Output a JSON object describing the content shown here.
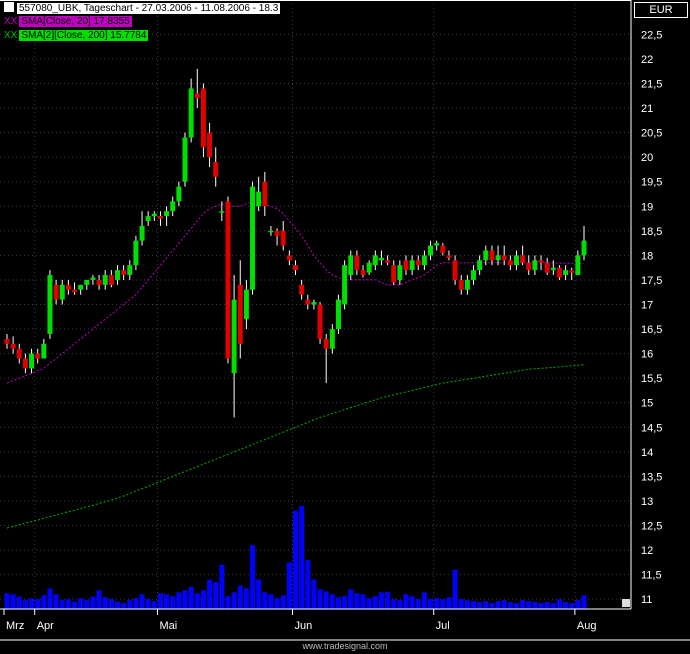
{
  "header": {
    "instrument_label": "557080_UBK, Tageschart - 27.03.2006 - 11.08.2006 - 18.3",
    "sma20_tag": "XX",
    "sma20_label": "SMA[Close, 20] 17.8355",
    "sma200_tag": "XX",
    "sma200_label": "SMA[2][Close, 200] 15.7784",
    "currency": "EUR"
  },
  "footer": {
    "credit": "www.tradesignal.com"
  },
  "colors": {
    "up": "#00e000",
    "down": "#e00000",
    "sma20": "#c000c0",
    "sma200": "#00b000",
    "volume": "#0000ff",
    "grid": "#3c3c3c"
  },
  "chart_data": {
    "type": "candlestick",
    "title": "557080_UBK, Tageschart - 27.03.2006 - 11.08.2006 - 18.3",
    "y_ticks": [
      "11",
      "11,5",
      "12",
      "12,5",
      "13",
      "13,5",
      "14",
      "14,5",
      "15",
      "15,5",
      "16",
      "16,5",
      "17",
      "17,5",
      "18",
      "18,5",
      "19",
      "19,5",
      "20",
      "20,5",
      "21",
      "21,5",
      "22",
      "22,5"
    ],
    "y_tick_values": [
      11,
      11.5,
      12,
      12.5,
      13,
      13.5,
      14,
      14.5,
      15,
      15.5,
      16,
      16.5,
      17,
      17.5,
      18,
      18.5,
      19,
      19.5,
      20,
      20.5,
      21,
      21.5,
      22,
      22.5
    ],
    "ylim": [
      10.8,
      23.2
    ],
    "x_labels": [
      "Mrz",
      "Apr",
      "Mai",
      "Jun",
      "Jul",
      "Aug"
    ],
    "x_label_index": [
      0,
      5,
      25,
      47,
      70,
      93
    ],
    "grid": true,
    "series": [
      {
        "name": "557080_UBK",
        "ohlc": [
          [
            16.3,
            16.4,
            16.1,
            16.2
          ],
          [
            16.2,
            16.35,
            16.0,
            16.1
          ],
          [
            16.1,
            16.2,
            15.8,
            15.9
          ],
          [
            15.9,
            16.0,
            15.6,
            15.7
          ],
          [
            15.7,
            16.1,
            15.6,
            16.0
          ],
          [
            16.0,
            16.1,
            15.8,
            15.9
          ],
          [
            15.9,
            16.3,
            15.9,
            16.2
          ],
          [
            16.4,
            17.7,
            16.3,
            17.6
          ],
          [
            17.4,
            17.5,
            17.0,
            17.1
          ],
          [
            17.1,
            17.5,
            17.0,
            17.4
          ],
          [
            17.4,
            17.5,
            17.2,
            17.3
          ],
          [
            17.3,
            17.45,
            17.2,
            17.25
          ],
          [
            17.3,
            17.4,
            17.2,
            17.4
          ],
          [
            17.4,
            17.5,
            17.3,
            17.5
          ],
          [
            17.5,
            17.6,
            17.4,
            17.55
          ],
          [
            17.5,
            17.6,
            17.3,
            17.4
          ],
          [
            17.4,
            17.7,
            17.3,
            17.6
          ],
          [
            17.6,
            17.7,
            17.35,
            17.4
          ],
          [
            17.5,
            17.8,
            17.4,
            17.7
          ],
          [
            17.7,
            17.8,
            17.5,
            17.6
          ],
          [
            17.6,
            17.9,
            17.5,
            17.8
          ],
          [
            17.8,
            18.4,
            17.7,
            18.3
          ],
          [
            18.3,
            18.9,
            18.2,
            18.6
          ],
          [
            18.7,
            18.9,
            18.6,
            18.8
          ],
          [
            18.8,
            18.9,
            18.7,
            18.85
          ],
          [
            18.8,
            18.9,
            18.6,
            18.75
          ],
          [
            18.8,
            19.0,
            18.6,
            18.9
          ],
          [
            18.9,
            19.2,
            18.8,
            19.1
          ],
          [
            19.1,
            19.5,
            19.0,
            19.4
          ],
          [
            19.5,
            20.5,
            19.4,
            20.4
          ],
          [
            20.4,
            21.6,
            20.3,
            21.4
          ],
          [
            21.3,
            21.8,
            21.0,
            21.2
          ],
          [
            21.4,
            21.5,
            20.0,
            20.2
          ],
          [
            20.5,
            20.7,
            19.8,
            20.0
          ],
          [
            19.9,
            20.2,
            19.4,
            19.6
          ],
          [
            18.9,
            19.1,
            18.7,
            18.9
          ],
          [
            19.1,
            19.2,
            15.8,
            15.9
          ],
          [
            15.6,
            17.6,
            14.7,
            17.1
          ],
          [
            17.4,
            17.9,
            15.9,
            16.2
          ],
          [
            16.7,
            17.5,
            16.5,
            17.3
          ],
          [
            17.3,
            19.5,
            17.2,
            19.4
          ],
          [
            19.0,
            19.6,
            18.9,
            19.3
          ],
          [
            19.5,
            19.7,
            18.8,
            19.0
          ],
          [
            18.5,
            18.6,
            18.4,
            18.5
          ],
          [
            18.5,
            18.55,
            18.2,
            18.4
          ],
          [
            18.5,
            18.7,
            18.1,
            18.2
          ],
          [
            18.0,
            18.1,
            17.8,
            17.9
          ],
          [
            17.8,
            17.9,
            17.6,
            17.7
          ],
          [
            17.4,
            17.5,
            17.1,
            17.2
          ],
          [
            17.1,
            17.2,
            16.9,
            17.0
          ],
          [
            17.0,
            17.1,
            16.9,
            17.05
          ],
          [
            17.0,
            17.05,
            16.2,
            16.3
          ],
          [
            16.3,
            16.4,
            15.4,
            16.1
          ],
          [
            16.1,
            16.6,
            16.0,
            16.5
          ],
          [
            16.5,
            17.2,
            16.4,
            17.1
          ],
          [
            17.0,
            17.9,
            16.9,
            17.8
          ],
          [
            17.6,
            18.1,
            17.5,
            18.0
          ],
          [
            18.0,
            18.1,
            17.6,
            17.7
          ],
          [
            17.7,
            17.8,
            17.55,
            17.6
          ],
          [
            17.65,
            17.9,
            17.6,
            17.85
          ],
          [
            17.8,
            18.1,
            17.7,
            18.0
          ],
          [
            17.9,
            18.1,
            17.8,
            17.95
          ],
          [
            17.9,
            18.0,
            17.8,
            17.85
          ],
          [
            17.8,
            17.9,
            17.4,
            17.45
          ],
          [
            17.5,
            17.9,
            17.4,
            17.8
          ],
          [
            17.9,
            18.0,
            17.6,
            17.7
          ],
          [
            17.7,
            18.0,
            17.6,
            17.9
          ],
          [
            17.9,
            18.0,
            17.7,
            17.8
          ],
          [
            17.8,
            18.1,
            17.7,
            18.0
          ],
          [
            18.0,
            18.3,
            17.9,
            18.2
          ],
          [
            18.2,
            18.3,
            18.1,
            18.25
          ],
          [
            18.2,
            18.25,
            18.0,
            18.05
          ],
          [
            18.0,
            18.1,
            17.9,
            17.95
          ],
          [
            17.9,
            18.0,
            17.4,
            17.5
          ],
          [
            17.5,
            17.6,
            17.2,
            17.3
          ],
          [
            17.3,
            17.6,
            17.2,
            17.5
          ],
          [
            17.5,
            17.8,
            17.4,
            17.7
          ],
          [
            17.7,
            18.0,
            17.6,
            17.9
          ],
          [
            17.9,
            18.2,
            17.8,
            18.1
          ],
          [
            18.1,
            18.2,
            17.8,
            17.9
          ],
          [
            17.9,
            18.2,
            17.8,
            18.0
          ],
          [
            18.0,
            18.2,
            17.8,
            17.9
          ],
          [
            17.9,
            18.0,
            17.7,
            17.8
          ],
          [
            17.8,
            18.1,
            17.7,
            18.0
          ],
          [
            18.0,
            18.2,
            17.8,
            17.85
          ],
          [
            17.85,
            18.0,
            17.6,
            17.7
          ],
          [
            17.7,
            18.0,
            17.6,
            17.9
          ],
          [
            17.9,
            18.0,
            17.7,
            17.85
          ],
          [
            17.85,
            17.95,
            17.6,
            17.65
          ],
          [
            17.7,
            17.9,
            17.6,
            17.75
          ],
          [
            17.75,
            17.8,
            17.5,
            17.55
          ],
          [
            17.6,
            17.8,
            17.5,
            17.7
          ],
          [
            17.7,
            17.75,
            17.5,
            17.65
          ],
          [
            17.6,
            18.1,
            17.6,
            18.0
          ],
          [
            18.0,
            18.6,
            17.9,
            18.3
          ]
        ],
        "up_color": "#00e000",
        "down_color": "#e00000"
      },
      {
        "name": "SMA[Close, 20]",
        "start_index": 0,
        "values": [
          15.4,
          15.45,
          15.5,
          15.55,
          15.6,
          15.65,
          15.7,
          15.8,
          15.9,
          16.0,
          16.1,
          16.2,
          16.3,
          16.4,
          16.5,
          16.6,
          16.7,
          16.8,
          16.9,
          17.0,
          17.1,
          17.2,
          17.35,
          17.5,
          17.65,
          17.8,
          17.95,
          18.1,
          18.25,
          18.4,
          18.55,
          18.7,
          18.85,
          18.95,
          19.0,
          19.05,
          19.0,
          19.0,
          19.0,
          19.05,
          19.1,
          19.1,
          19.05,
          19.0,
          18.95,
          18.85,
          18.7,
          18.55,
          18.4,
          18.2,
          18.0,
          17.85,
          17.7,
          17.6,
          17.55,
          17.5,
          17.5,
          17.5,
          17.5,
          17.5,
          17.5,
          17.45,
          17.4,
          17.4,
          17.4,
          17.45,
          17.5,
          17.55,
          17.6,
          17.7,
          17.8,
          17.85,
          17.85,
          17.85,
          17.85,
          17.85,
          17.85,
          17.85,
          17.85,
          17.85,
          17.85,
          17.85,
          17.85,
          17.85,
          17.85,
          17.85,
          17.85,
          17.85,
          17.85,
          17.85,
          17.84,
          17.84,
          17.84,
          17.84,
          17.8355
        ]
      },
      {
        "name": "SMA[2][Close, 200]",
        "start_index": 0,
        "values": [
          12.45,
          12.48,
          12.52,
          12.55,
          12.58,
          12.61,
          12.65,
          12.68,
          12.71,
          12.75,
          12.78,
          12.81,
          12.85,
          12.88,
          12.91,
          12.95,
          12.98,
          13.02,
          13.06,
          13.1,
          13.15,
          13.2,
          13.25,
          13.3,
          13.35,
          13.4,
          13.45,
          13.5,
          13.55,
          13.6,
          13.65,
          13.7,
          13.75,
          13.8,
          13.85,
          13.9,
          13.95,
          14.0,
          14.05,
          14.1,
          14.15,
          14.2,
          14.25,
          14.3,
          14.35,
          14.4,
          14.45,
          14.5,
          14.55,
          14.6,
          14.65,
          14.7,
          14.74,
          14.78,
          14.82,
          14.86,
          14.9,
          14.94,
          14.98,
          15.02,
          15.06,
          15.1,
          15.13,
          15.16,
          15.19,
          15.22,
          15.25,
          15.28,
          15.31,
          15.34,
          15.37,
          15.4,
          15.42,
          15.44,
          15.46,
          15.48,
          15.5,
          15.52,
          15.54,
          15.56,
          15.58,
          15.6,
          15.62,
          15.64,
          15.66,
          15.68,
          15.69,
          15.7,
          15.71,
          15.72,
          15.73,
          15.74,
          15.75,
          15.76,
          15.7784
        ]
      },
      {
        "name": "Volume",
        "values": [
          0.32,
          0.3,
          0.25,
          0.18,
          0.22,
          0.2,
          0.28,
          0.42,
          0.3,
          0.18,
          0.2,
          0.15,
          0.22,
          0.18,
          0.25,
          0.38,
          0.24,
          0.2,
          0.15,
          0.12,
          0.18,
          0.22,
          0.3,
          0.2,
          0.16,
          0.32,
          0.3,
          0.26,
          0.34,
          0.38,
          0.45,
          0.32,
          0.38,
          0.6,
          0.55,
          0.9,
          0.26,
          0.34,
          0.48,
          0.42,
          1.3,
          0.6,
          0.34,
          0.3,
          0.22,
          0.28,
          0.95,
          2.0,
          2.1,
          1.0,
          0.6,
          0.4,
          0.36,
          0.3,
          0.24,
          0.26,
          0.4,
          0.32,
          0.3,
          0.22,
          0.26,
          0.34,
          0.35,
          0.2,
          0.18,
          0.3,
          0.26,
          0.2,
          0.34,
          0.2,
          0.22,
          0.2,
          0.24,
          0.8,
          0.2,
          0.18,
          0.16,
          0.14,
          0.16,
          0.12,
          0.16,
          0.18,
          0.14,
          0.12,
          0.18,
          0.16,
          0.14,
          0.12,
          0.14,
          0.12,
          0.2,
          0.14,
          0.12,
          0.18,
          0.28
        ]
      }
    ]
  }
}
